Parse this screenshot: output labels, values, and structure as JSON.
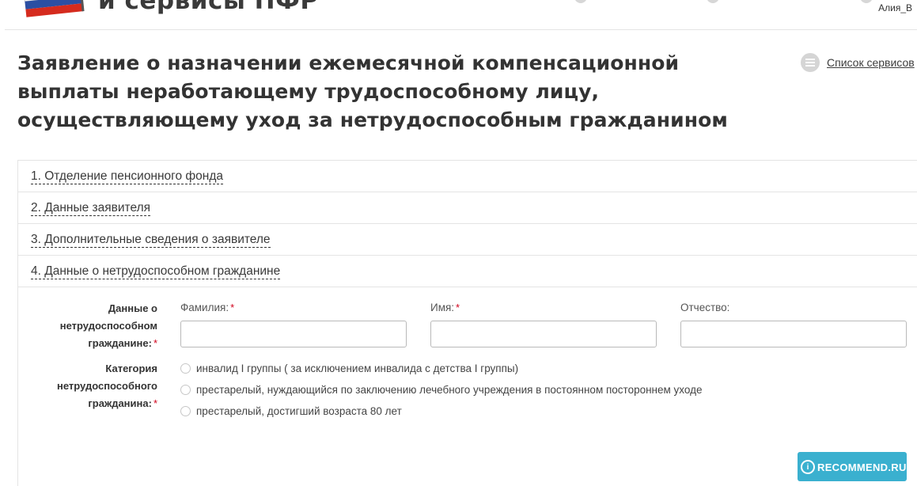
{
  "header": {
    "brand_text": "и сервисы ПФР",
    "user_name": "Алия_В"
  },
  "page": {
    "title": "Заявление о назначении ежемесячной компенсационной выплаты неработающему трудоспособному лицу, осуществляющему уход за нетрудоспособным гражданином",
    "services_link": "Список сервисов"
  },
  "sections": [
    {
      "label": "1. Отделение пенсионного фонда"
    },
    {
      "label": "2. Данные заявителя"
    },
    {
      "label": "3. Дополнительные сведения о заявителе"
    },
    {
      "label": "4. Данные о нетрудоспособном гражданине"
    }
  ],
  "form": {
    "citizen_data_label": "Данные о нетрудоспособном гражданине:",
    "required_mark": "*",
    "surname": {
      "label": "Фамилия:",
      "value": ""
    },
    "name": {
      "label": "Имя:",
      "value": ""
    },
    "patronymic": {
      "label": "Отчество:",
      "value": ""
    },
    "category_label": "Категория нетрудоспособного гражданина:",
    "category_options": [
      "инвалид I группы ( за исключением инвалида с детства I группы)",
      "престарелый, нуждающийся по заключению лечебного учреждения в постоянном постороннем уходе",
      "престарелый, достигший возраста 80 лет"
    ],
    "selected_category": null
  },
  "watermark": {
    "logo_letter": "i",
    "text": "RECOMMEND.RU"
  },
  "colors": {
    "button": "#3ab0cf",
    "required": "#d0021b",
    "text": "#333333",
    "border": "#e4e4e4"
  }
}
